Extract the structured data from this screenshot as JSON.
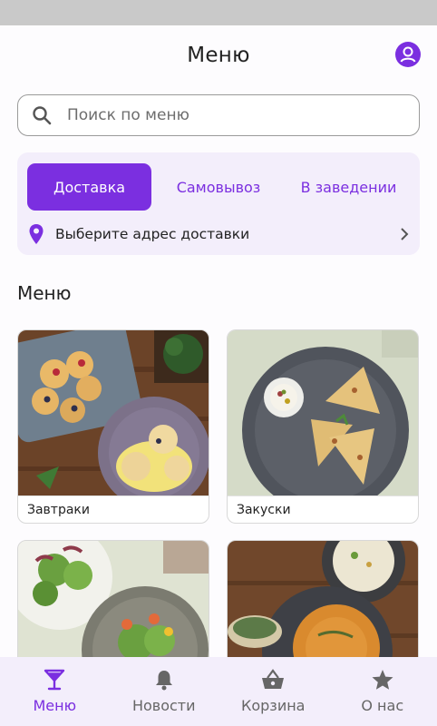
{
  "header": {
    "title": "Меню"
  },
  "search": {
    "placeholder": "Поиск по меню"
  },
  "order_modes": {
    "tabs": [
      "Доставка",
      "Самовывоз",
      "В заведении"
    ],
    "active": "Доставка"
  },
  "address": {
    "label": "Выберите адрес доставки"
  },
  "section": {
    "title": "Меню"
  },
  "categories": [
    {
      "name": "Завтраки",
      "image": "breakfast-photo"
    },
    {
      "name": "Закуски",
      "image": "appetizers-photo"
    },
    {
      "name": "",
      "image": "salads-photo"
    },
    {
      "name": "",
      "image": "soups-photo"
    }
  ],
  "bottom_nav": [
    {
      "label": "Меню",
      "icon": "cocktail-icon",
      "active": true
    },
    {
      "label": "Новости",
      "icon": "bell-icon",
      "active": false
    },
    {
      "label": "Корзина",
      "icon": "basket-icon",
      "active": false
    },
    {
      "label": "О нас",
      "icon": "star-icon",
      "active": false
    }
  ],
  "colors": {
    "accent": "#7b2fe0",
    "card_bg": "#f3eefb",
    "nav_inactive": "#666666"
  }
}
